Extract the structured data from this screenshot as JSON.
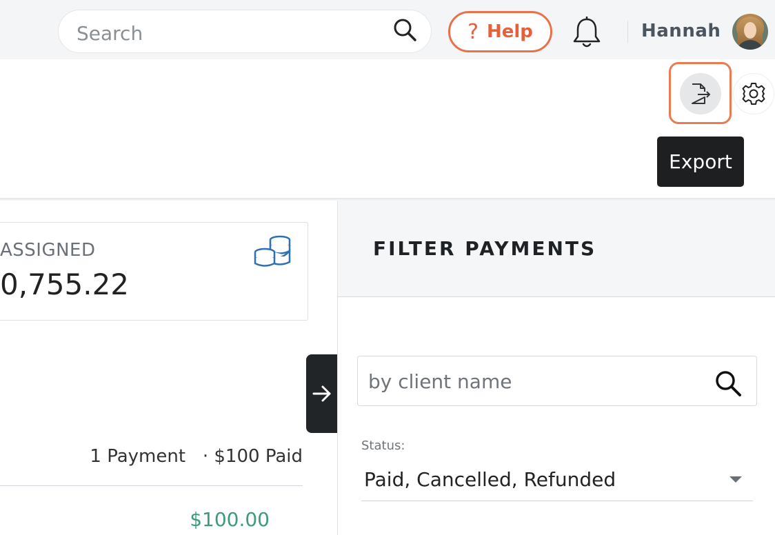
{
  "header": {
    "search_placeholder": "Search",
    "help_label": "Help",
    "user_name": "Hannah"
  },
  "toolbar": {
    "export_tooltip": "Export"
  },
  "summary": {
    "label": "ASSIGNED",
    "value": "0,755.22"
  },
  "payments": {
    "summary_count": "1 Payment",
    "summary_paid": "· $100 Paid",
    "amount": "$100.00"
  },
  "filter": {
    "title": "FILTER PAYMENTS",
    "client_placeholder": "by client name",
    "status_label": "Status:",
    "status_value": "Paid, Cancelled, Refunded"
  },
  "colors": {
    "accent": "#e8714a",
    "amount_green": "#3d9b7c",
    "coin_blue": "#2f6fb3"
  },
  "icons": [
    "search-icon",
    "help-icon",
    "bell-icon",
    "export-icon",
    "gear-icon",
    "coins-icon",
    "arrow-right-icon",
    "chevron-down-icon"
  ]
}
